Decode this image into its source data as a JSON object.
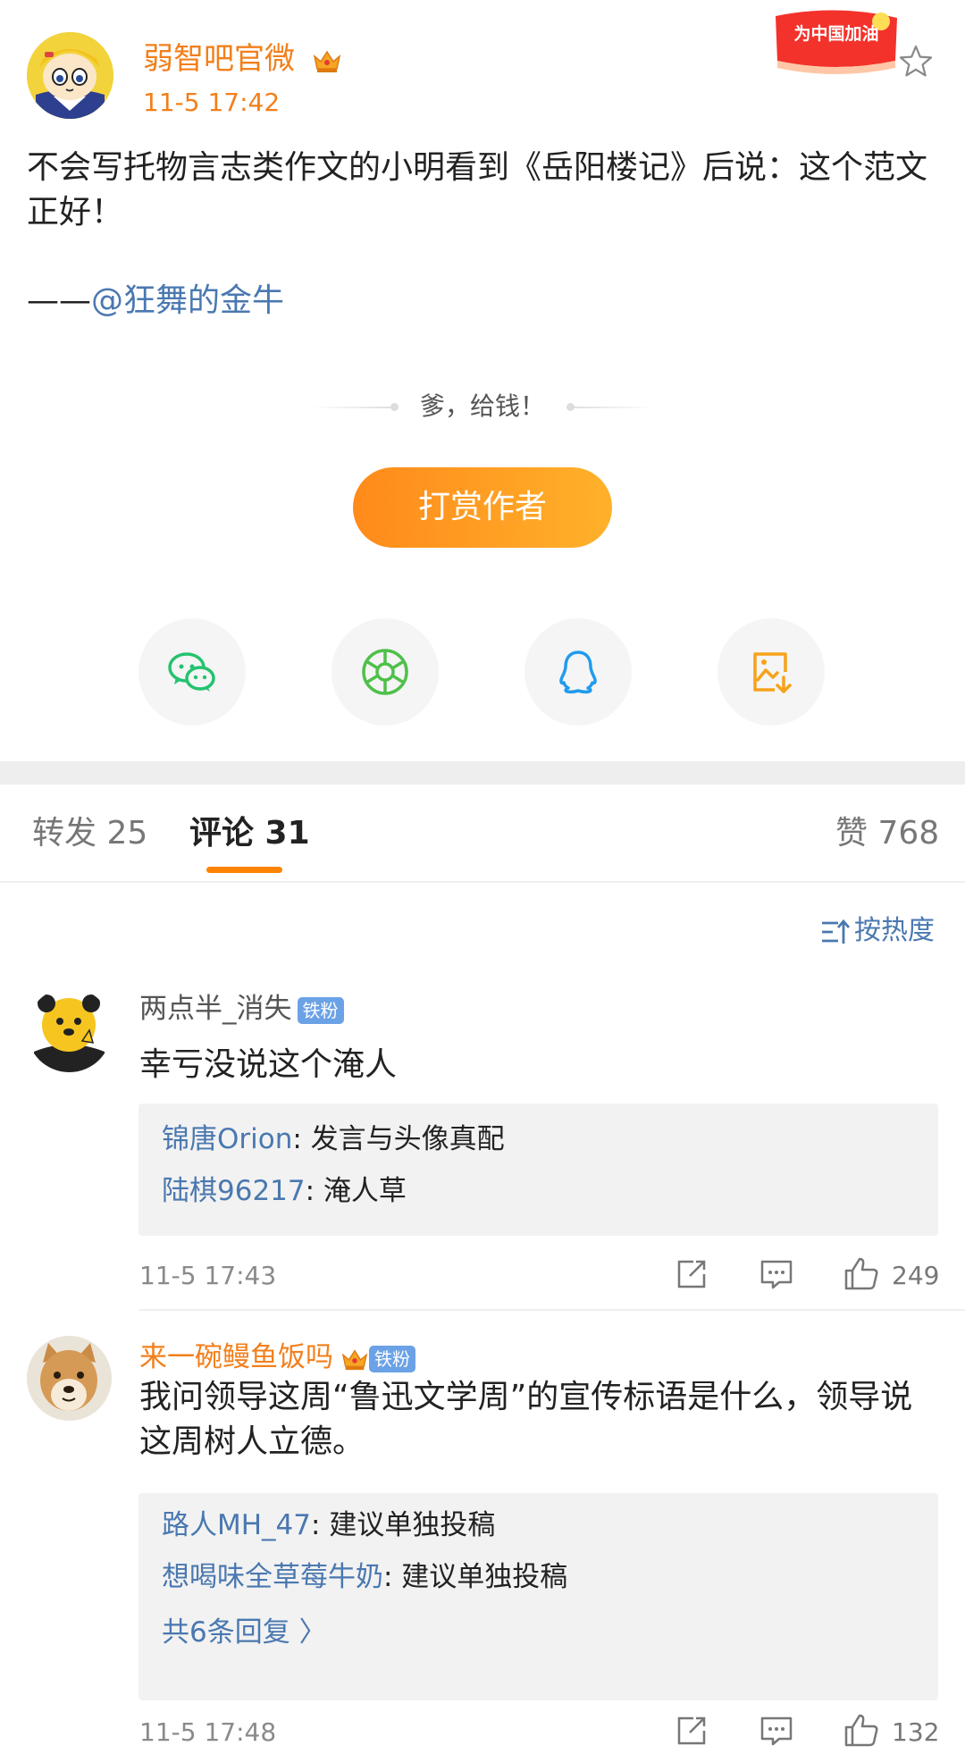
{
  "post": {
    "author": "弱智吧官微",
    "time": "11-5 17:42",
    "badge_text": "为中国加油",
    "text": "不会写托物言志类作文的小明看到《岳阳楼记》后说：这个范文正好！",
    "signature_prefix": "——",
    "signature_mention": "@狂舞的金牛",
    "tip_text": "爹，给钱！",
    "reward_label": "打赏作者"
  },
  "share": [
    {
      "icon": "wechat-icon",
      "color": "#25c26f"
    },
    {
      "icon": "moments-icon",
      "color": "#4fc04a"
    },
    {
      "icon": "qq-icon",
      "color": "#1f9bef"
    },
    {
      "icon": "save-image-icon",
      "color": "#f7a21a"
    }
  ],
  "tabs": {
    "repost": "转发 25",
    "comment": "评论 31",
    "like": "赞 768"
  },
  "sort_label": "按热度",
  "comments": [
    {
      "name": "两点半_消失",
      "badge": "铁粉",
      "text": "幸亏没说这个淹人",
      "replies": [
        {
          "name": "锦唐Orion",
          "text": ": 发言与头像真配"
        },
        {
          "name": "陆棋96217",
          "text": ": 淹人草"
        }
      ],
      "time": "11-5 17:43",
      "likes": "249"
    },
    {
      "name": "来一碗鳗鱼饭吗",
      "badge": "铁粉",
      "text": "我问领导这周“鲁迅文学周”的宣传标语是什么，领导说这周树人立德。",
      "replies": [
        {
          "name": "路人MH_47",
          "text": ": 建议单独投稿"
        },
        {
          "name": "想喝味全草莓牛奶",
          "text": ": 建议单独投稿"
        }
      ],
      "more_replies": "共6条回复 〉",
      "time": "11-5 17:48",
      "likes": "132"
    }
  ]
}
